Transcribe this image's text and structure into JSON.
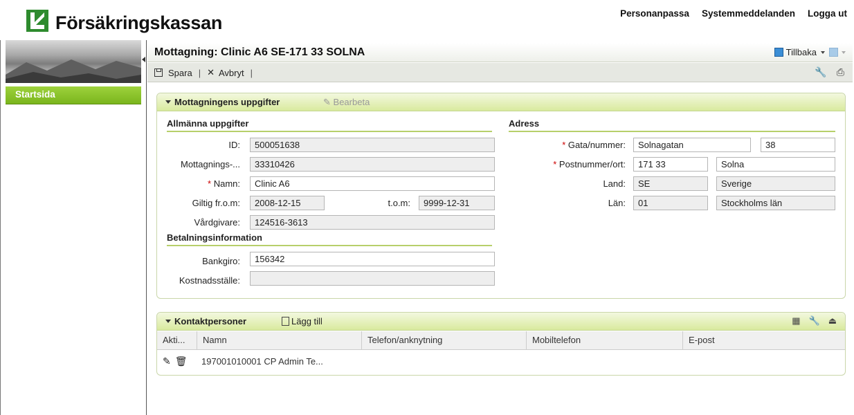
{
  "brand": {
    "name": "Försäkringskassan",
    "color": "#2e8b2e"
  },
  "top_links": [
    "Personanpassa",
    "Systemmeddelanden",
    "Logga ut"
  ],
  "nav": {
    "start": "Startsida",
    "accent": "#8cc63f"
  },
  "title": "Mottagning: Clinic A6 SE-171 33 SOLNA",
  "back": "Tillbaka",
  "toolbar": {
    "save": "Spara",
    "cancel": "Avbryt"
  },
  "panel1": {
    "title": "Mottagningens uppgifter",
    "edit": "Bearbeta",
    "general": {
      "title": "Allmänna uppgifter",
      "id_label": "ID:",
      "id": "500051638",
      "mott_label": "Mottagnings-...",
      "mott": "33310426",
      "name_label": "Namn:",
      "name": "Clinic A6",
      "from_label": "Giltig fr.o.m:",
      "from": "2008-12-15",
      "to_label": "t.o.m:",
      "to": "9999-12-31",
      "provider_label": "Vårdgivare:",
      "provider": "124516-3613"
    },
    "payment": {
      "title": "Betalningsinformation",
      "bankgiro_label": "Bankgiro:",
      "bankgiro": "156342",
      "cost_label": "Kostnadsställe:",
      "cost": ""
    },
    "address": {
      "title": "Adress",
      "street_label": "Gata/nummer:",
      "street": "Solnagatan",
      "number": "38",
      "zip_label": "Postnummer/ort:",
      "zip": "171 33",
      "city": "Solna",
      "country_label": "Land:",
      "country_code": "SE",
      "country": "Sverige",
      "county_label": "Län:",
      "county_code": "01",
      "county": "Stockholms län"
    }
  },
  "panel2": {
    "title": "Kontaktpersoner",
    "add": "Lägg till",
    "columns": [
      "Akti...",
      "Namn",
      "Telefon/anknytning",
      "Mobiltelefon",
      "E-post"
    ],
    "rows": [
      {
        "name": "197001010001 CP Admin Te..."
      }
    ]
  }
}
